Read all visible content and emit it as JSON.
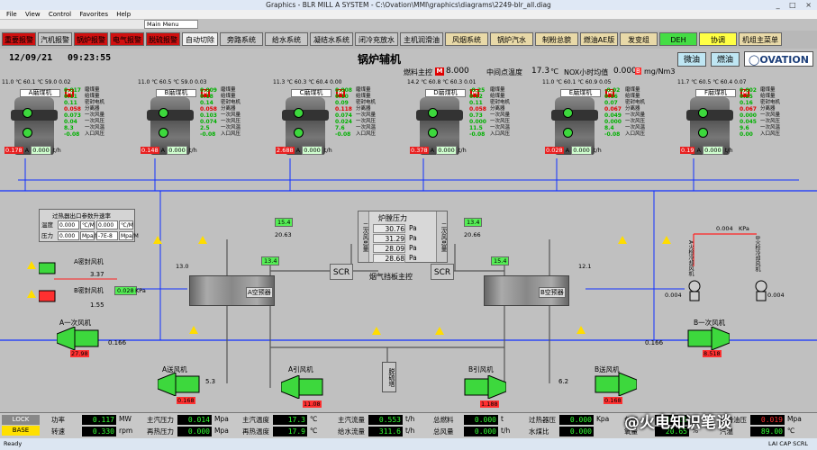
{
  "window": {
    "title": "Graphics - BLR MILL A SYSTEM - C:\\Ovation\\MMI\\graphics\\diagrams\\2249-blr_all.diag",
    "controls": "_ □ ×"
  },
  "menu": [
    "File",
    "View",
    "Control",
    "Favorites",
    "Help"
  ],
  "main_menu_select": "Main Menu",
  "nav": [
    {
      "label": "重要报警",
      "style": "alarm"
    },
    {
      "label": "汽机报警",
      "style": "normal"
    },
    {
      "label": "锅炉报警",
      "style": "alarm"
    },
    {
      "label": "电气报警",
      "style": "alarm"
    },
    {
      "label": "脱硫报警",
      "style": "alarm"
    },
    {
      "label": "自动切除",
      "style": "white"
    },
    {
      "label": "旁路系统",
      "style": "normal"
    },
    {
      "label": "给水系统",
      "style": "normal"
    },
    {
      "label": "凝结水系统",
      "style": "normal"
    },
    {
      "label": "闭冷充放水",
      "style": "normal"
    },
    {
      "label": "主机润滑油",
      "style": "normal"
    },
    {
      "label": "风烟系统",
      "style": "tan"
    },
    {
      "label": "锅炉汽水",
      "style": "tan"
    },
    {
      "label": "制粉总貌",
      "style": "tan"
    },
    {
      "label": "燃油AE版",
      "style": "tan"
    },
    {
      "label": "发变组",
      "style": "tan"
    },
    {
      "label": "DEH",
      "style": "green"
    },
    {
      "label": "协调",
      "style": "yellow"
    },
    {
      "label": "机组主菜单",
      "style": "tan"
    }
  ],
  "header": {
    "date": "12/09/21",
    "time": "09:23:55",
    "page_title": "锅炉辅机",
    "fuel_label": "燃料主控",
    "fuel_badge": "M",
    "fuel_value": "8.000",
    "mid_temp_label": "中间点温度",
    "mid_temp_value": "17.3",
    "mid_temp_unit": "℃",
    "nox_label": "NOX小时均值",
    "nox_value": "0.000",
    "nox_badge": "B",
    "nox_unit": "mg/Nm3",
    "btn_light_oil": "微油",
    "btn_fuel_oil": "燃油",
    "logo": "OVATION"
  },
  "mills": [
    {
      "name": "A磨煤机",
      "temp": "11.0",
      "mid": "60.1",
      "rest": "59.0  0.02",
      "r1": "0.017",
      "r2": "0.11",
      "r3": "0.11",
      "r4": "0.058",
      "r5": "0.073",
      "r6": "0.04",
      "r7": "8.3",
      "r8": "-0.08",
      "amp": "0.178",
      "bottom": "0.000"
    },
    {
      "name": "B磨煤机",
      "temp": "11.0",
      "mid": "60.5",
      "rest": "59.0  0.03",
      "r1": "0.009",
      "r2": "0.18",
      "r3": "0.14",
      "r4": "0.058",
      "r5": "0.103",
      "r6": "0.074",
      "r7": "2.5",
      "r8": "-0.08",
      "amp": "0.148",
      "bottom": "0.000"
    },
    {
      "name": "C磨煤机",
      "temp": "11.3",
      "mid": "60.3",
      "rest": "60.4  0.00",
      "r1": "0.008",
      "r2": "0.10",
      "r3": "0.09",
      "r4": "0.118",
      "r5": "0.074",
      "r6": "0.024",
      "r7": "7.6",
      "r8": "-0.08",
      "amp": "2.688",
      "bottom": "0.000"
    },
    {
      "name": "D磨煤机",
      "temp": "14.2",
      "mid": "60.8",
      "rest": "60.3  0.01",
      "r1": "-0.25",
      "r2": "0.12",
      "r3": "0.11",
      "r4": "0.058",
      "r5": "0.73",
      "r6": "0.000",
      "r7": "11.5",
      "r8": "-0.08",
      "amp": "0.378",
      "bottom": "0.000"
    },
    {
      "name": "E磨煤机",
      "temp": "11.0",
      "mid": "60.1",
      "rest": "60.9  0.05",
      "r1": "-0.02",
      "r2": "0.16",
      "r3": "0.07",
      "r4": "0.067",
      "r5": "0.049",
      "r6": "0.000",
      "r7": "8.4",
      "r8": "-0.08",
      "amp": "0.028",
      "bottom": "0.000"
    },
    {
      "name": "F磨煤机",
      "temp": "11.7",
      "mid": "60.5",
      "rest": "60.4  0.07",
      "r1": "0.002",
      "r2": "0.25",
      "r3": "0.16",
      "r4": "0.067",
      "r5": "0.000",
      "r6": "0.045",
      "r7": "9.6",
      "r8": "0.00",
      "amp": "0.19",
      "bottom": "0.000"
    }
  ],
  "mill_row_labels": [
    "磨煤量",
    "给煤量",
    "密封电机",
    "分离器",
    "一次风量",
    "一次风压",
    "一次风温",
    "入口风压"
  ],
  "process": {
    "speed_table": {
      "title": "过热器出口参数升速率",
      "row1": "温度",
      "row2": "压力",
      "v1": "0.000",
      "u1": "℃/M",
      "v2": "0.000",
      "u2": "℃/M",
      "v3": "0.000",
      "u3": "Mpa/M",
      "v4": "-7E-8",
      "u4": "Mpa/M"
    },
    "furnace": {
      "title": "炉膛压力",
      "left_label": "二次风总量",
      "right_label": "二次风总量",
      "values": [
        "30.76",
        "31.29",
        "28.09",
        "28.68"
      ],
      "unit": "Pa",
      "bottom_label": "烟气挡板主控"
    },
    "scr_left": "SCR",
    "scr_right": "SCR",
    "preheater_a": "A空预器",
    "preheater_b": "B空预器",
    "seal_fan_a": "A密封风机",
    "seal_fan_b": "B密封风机",
    "seal_a_val": "3.37",
    "seal_b_val": "1.55",
    "seal_out_val": "0.028",
    "seal_out_unit": "KPa",
    "pa_fan_a": "A一次风机",
    "pa_fan_b": "B一次风机",
    "pa_a_kpa": "0.166",
    "pa_b_kpa": "0.166",
    "pa_a_amp": "27.98",
    "pa_b_amp": "8.518",
    "id_fan_a": "A引风机",
    "id_fan_b": "B引风机",
    "fd_fan_a": "A送风机",
    "fd_fan_b": "B送风机",
    "id_a_amp": "11.08",
    "id_b_amp": "1.188",
    "fd_a_amp": "0.168",
    "fd_b_amp": "0.168",
    "fd_a_val": "5.3",
    "fd_b_val": "6.2",
    "desulf": "脱硫塔",
    "red_top": "0.004",
    "red_top_unit": "KPa",
    "scanner_a": "A火检冷却风机",
    "scanner_b": "B火检冷却风机",
    "scanner_val": "0.004",
    "scanner_val2": "0.004",
    "left_flow": "15.4",
    "right_flow": "13.4",
    "left_flow2": "20.63",
    "right_flow2": "20.66",
    "mid_left": "13.4",
    "mid_right": "15.4",
    "mid_left2": "13.0",
    "mid_right2": "12.1"
  },
  "status_bar": {
    "lock": "LOCK",
    "base": "BASE",
    "items": [
      {
        "label": "功率",
        "value": "0.117",
        "unit": "MW",
        "color": "green"
      },
      {
        "label": "主汽压力",
        "value": "0.014",
        "unit": "Mpa",
        "color": "green"
      },
      {
        "label": "主汽温度",
        "value": "17.3",
        "unit": "℃",
        "color": "green"
      },
      {
        "label": "主汽流量",
        "value": "0.553",
        "unit": "t/h",
        "color": "green"
      },
      {
        "label": "总燃料",
        "value": "0.000",
        "unit": "t",
        "color": "green"
      },
      {
        "label": "过热器压",
        "value": "0.000",
        "unit": "Kpa",
        "color": "green"
      },
      {
        "label": "负压",
        "value": "31.21",
        "unit": "Pa",
        "color": "green"
      },
      {
        "label": "润滑油压",
        "value": "0.019",
        "unit": "Mpa",
        "color": "red"
      },
      {
        "label": "转速",
        "value": "0.330",
        "unit": "rpm",
        "color": "green"
      },
      {
        "label": "再热压力",
        "value": "0.000",
        "unit": "Mpa",
        "color": "green"
      },
      {
        "label": "再热温度",
        "value": "17.9",
        "unit": "℃",
        "color": "green"
      },
      {
        "label": "给水流量",
        "value": "311.6",
        "unit": "t/h",
        "color": "green"
      },
      {
        "label": "总风量",
        "value": "0.000",
        "unit": "t/h",
        "color": "green"
      },
      {
        "label": "水煤比",
        "value": "0.000",
        "unit": "",
        "color": "green"
      },
      {
        "label": "氧量",
        "value": "20.65",
        "unit": "%",
        "color": "green"
      },
      {
        "label": "汽温",
        "value": "89.00",
        "unit": "℃",
        "color": "green"
      }
    ]
  },
  "watermark": "@火电知识笔谈",
  "taskbar": {
    "left": "Ready",
    "right": "LAI CAP SCRL"
  }
}
